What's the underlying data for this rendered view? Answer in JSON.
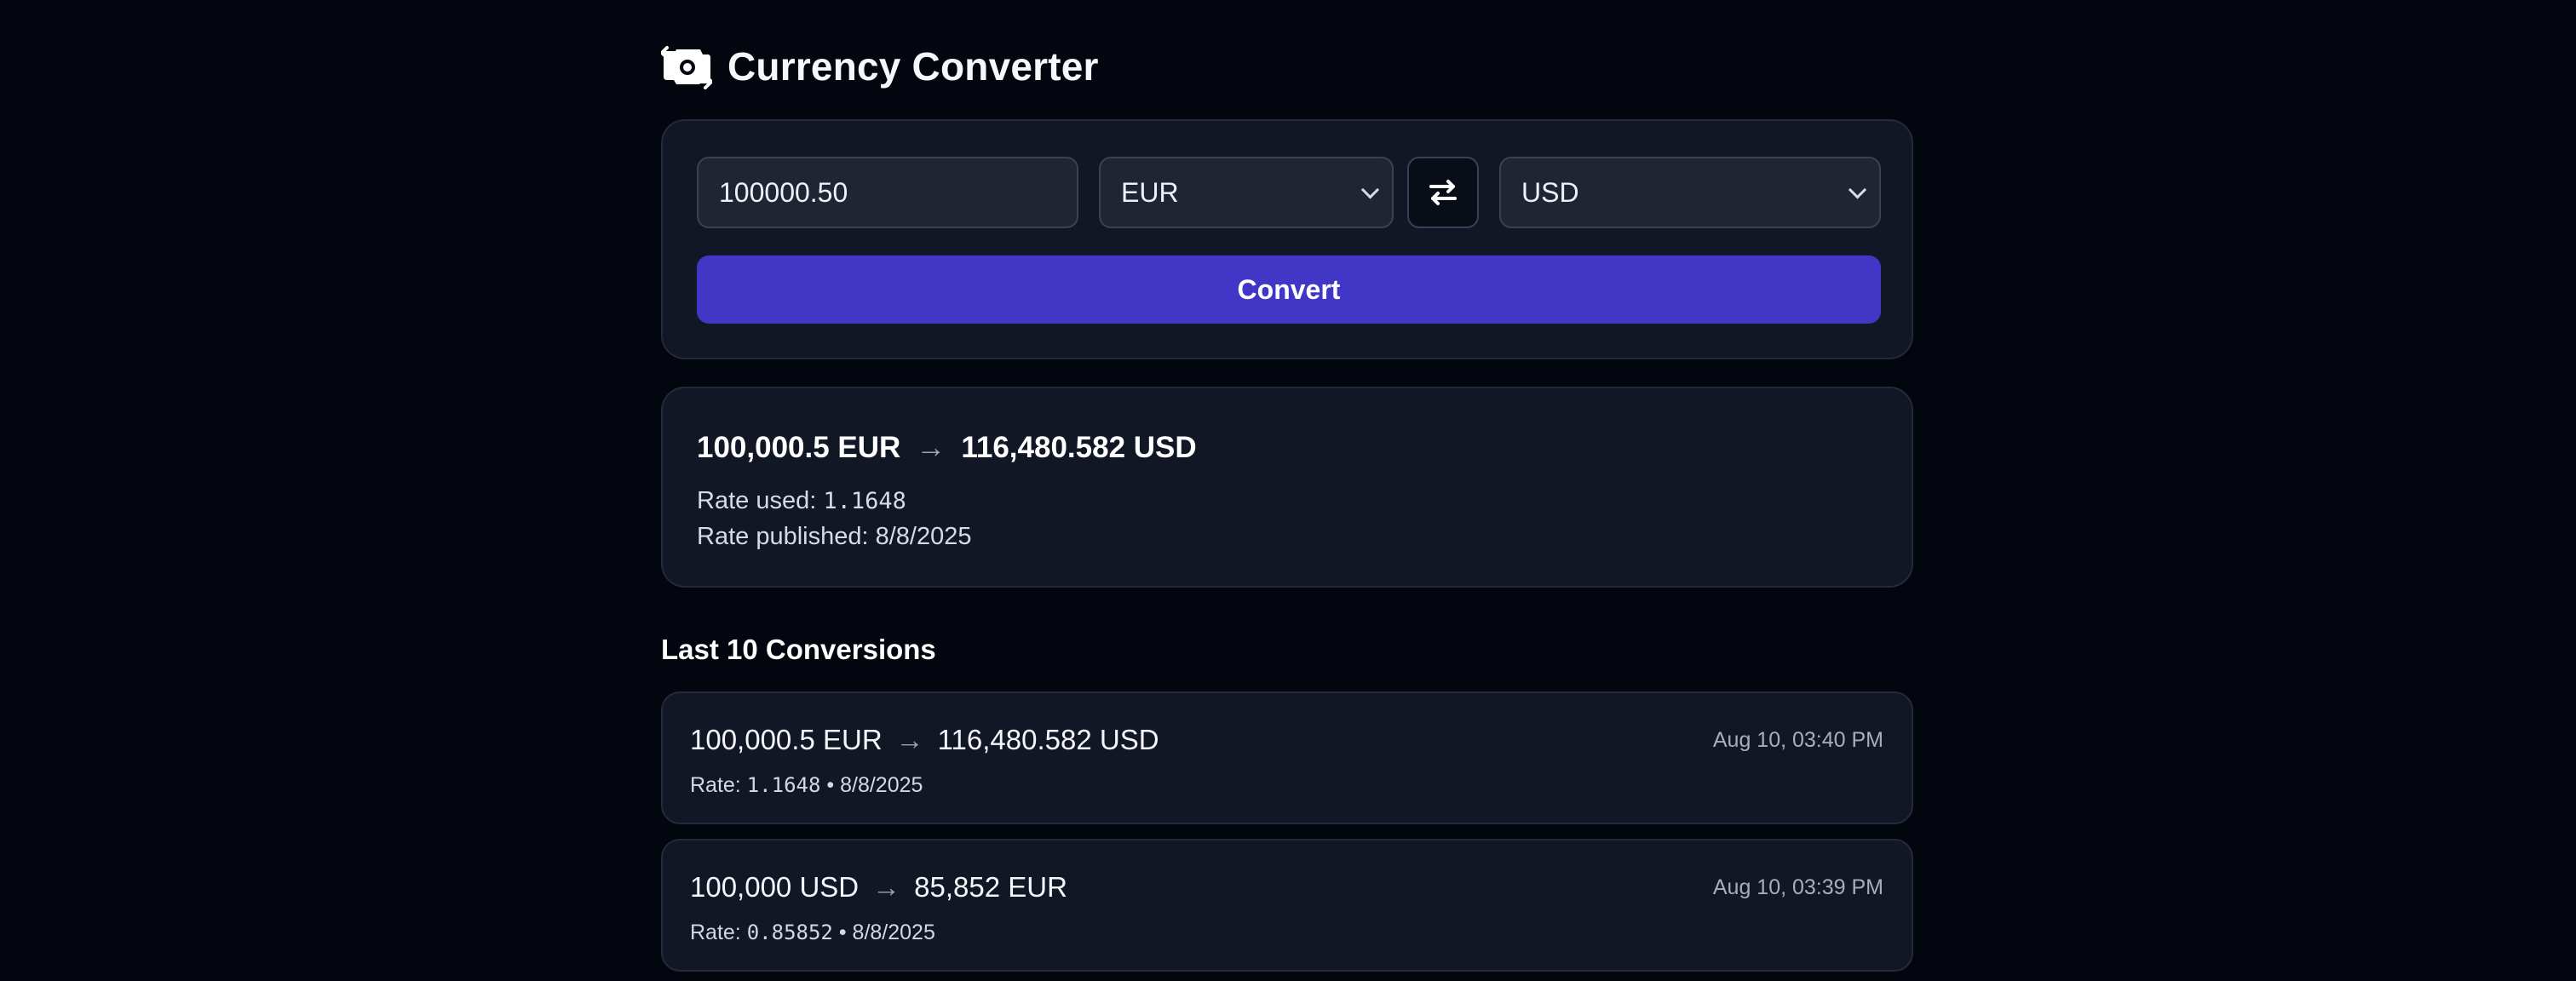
{
  "app": {
    "title": "Currency Converter",
    "icon": "currency-exchange-icon"
  },
  "form": {
    "amount": "100000.50",
    "from_currency": "EUR",
    "to_currency": "USD",
    "swap_icon": "swap-arrows-icon",
    "convert_label": "Convert"
  },
  "result": {
    "from_text": "100,000.5 EUR",
    "arrow": "→",
    "to_text": "116,480.582 USD",
    "rate_used_label": "Rate used:",
    "rate_used_value": "1.1648",
    "rate_published_label": "Rate published:",
    "rate_published_value": "8/8/2025"
  },
  "history": {
    "title": "Last 10 Conversions",
    "items": [
      {
        "from_text": "100,000.5 EUR",
        "arrow": "→",
        "to_text": "116,480.582 USD",
        "rate_label": "Rate:",
        "rate_value": "1.1648",
        "separator": "•",
        "published": "8/8/2025",
        "timestamp": "Aug 10, 03:40 PM"
      },
      {
        "from_text": "100,000 USD",
        "arrow": "→",
        "to_text": "85,852 EUR",
        "rate_label": "Rate:",
        "rate_value": "0.85852",
        "separator": "•",
        "published": "8/8/2025",
        "timestamp": "Aug 10, 03:39 PM"
      }
    ]
  },
  "colors": {
    "background": "#03060f",
    "card": "#111724",
    "border": "#232b3a",
    "input": "#1f2532",
    "accent": "#4236c6",
    "muted_text": "#a7afbd"
  }
}
